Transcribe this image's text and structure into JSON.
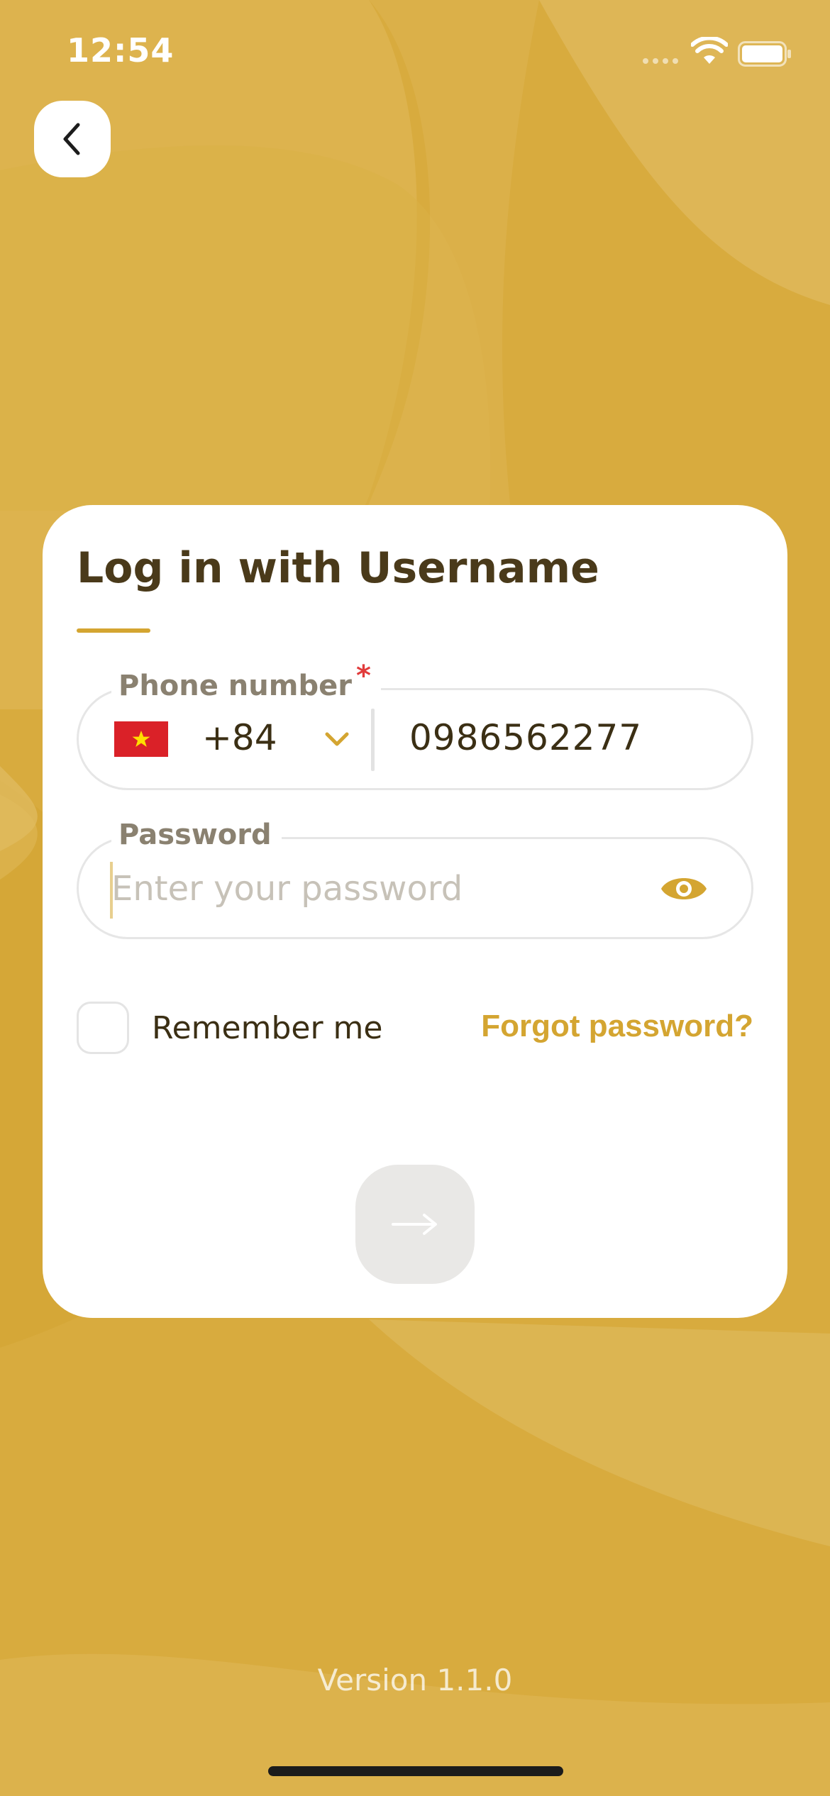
{
  "status_bar": {
    "time": "12:54"
  },
  "login_card": {
    "title": "Log in with Username",
    "phone_field": {
      "label": "Phone number",
      "required_mark": "*",
      "country_flag": "vietnam-flag",
      "dial_code": "+84",
      "value": "0986562277"
    },
    "password_field": {
      "label": "Password",
      "placeholder": "Enter your password",
      "value": ""
    },
    "remember_me": {
      "label": "Remember me",
      "checked": false
    },
    "forgot_password_label": "Forgot password?",
    "submit_icon": "arrow-right-icon"
  },
  "footer": {
    "version": "Version 1.1.0"
  },
  "colors": {
    "background": "#d8ab3e",
    "accent": "#d4a531",
    "title_text": "#4a3a1a",
    "required": "#e13b3b",
    "submit_disabled": "#e9e8e6"
  }
}
